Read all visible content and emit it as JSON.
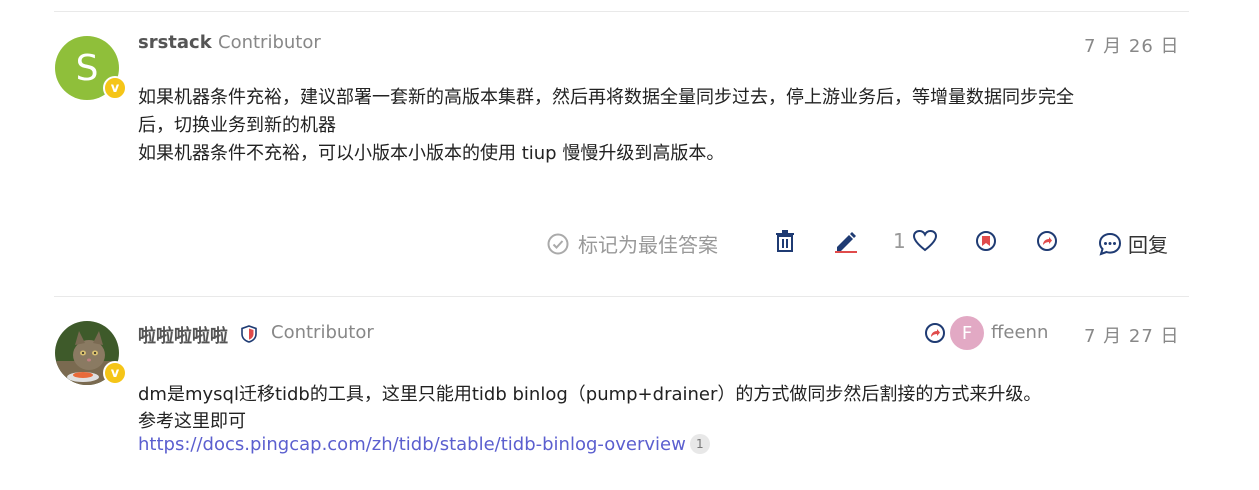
{
  "post1": {
    "avatar_letter": "S",
    "badge": "v",
    "username": "srstack",
    "title": "Contributor",
    "date": "7 月 26 日",
    "body": [
      "如果机器条件充裕，建议部署一套新的高版本集群，然后再将数据全量同步过去，停上游业务后，等增量数据同步完全",
      "后，切换业务到新的机器",
      "如果机器条件不充裕，可以小版本小版本的使用 tiup 慢慢升级到高版本。"
    ],
    "actions": {
      "solution_label": "标记为最佳答案",
      "like_count": "1",
      "reply_label": "回复"
    }
  },
  "post2": {
    "badge": "v",
    "username": "啦啦啦啦啦",
    "title": "Contributor",
    "reply_to_letter": "F",
    "reply_to_user": "ffeenn",
    "date": "7 月 27 日",
    "body": [
      "dm是mysql迁移tidb的工具，这里只能用tidb binlog（pump+drainer）的方式做同步然后割接的方式来升级。",
      "参考这里即可"
    ],
    "link": "https://docs.pingcap.com/zh/tidb/stable/tidb-binlog-overview",
    "link_clicks": "1"
  },
  "colors": {
    "accent": "#1f3b73",
    "link": "#5b5fcf",
    "badge": "#f5c518",
    "avatar_s": "#8fbf3a",
    "avatar_f": "#e2a9c4",
    "like_red": "#e04b4b"
  }
}
